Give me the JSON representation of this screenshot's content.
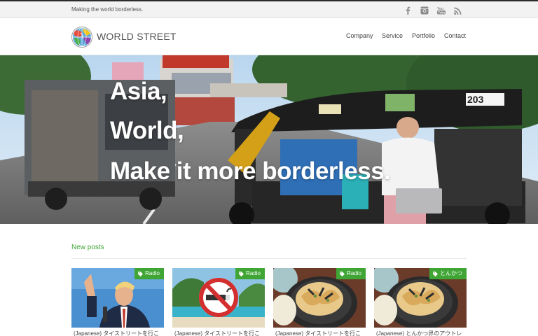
{
  "topbar": {
    "tagline": "Making the world borderless.",
    "social": [
      "facebook-icon",
      "instagram-icon",
      "youtube-icon",
      "rss-icon"
    ]
  },
  "header": {
    "logo_text": "WORLD STREET",
    "nav": [
      "Company",
      "Service",
      "Portfolio",
      "Contact"
    ]
  },
  "hero": {
    "lines": [
      "Asia,",
      "World,",
      "Make it more borderless."
    ]
  },
  "posts": {
    "title": "New posts",
    "items": [
      {
        "category": "Radio",
        "title": "(Japanese) タイストリートを行こ"
      },
      {
        "category": "Radio",
        "title": "(Japanese) タイストリートを行こ"
      },
      {
        "category": "Radio",
        "title": "(Japanese) タイストリートを行こ"
      },
      {
        "category": "とんかつ",
        "title": "(Japanese) とんかつ界のアウトレ"
      }
    ]
  },
  "colors": {
    "accent": "#3fa535",
    "topbar_bg": "#f2f2f2",
    "text": "#333333"
  }
}
